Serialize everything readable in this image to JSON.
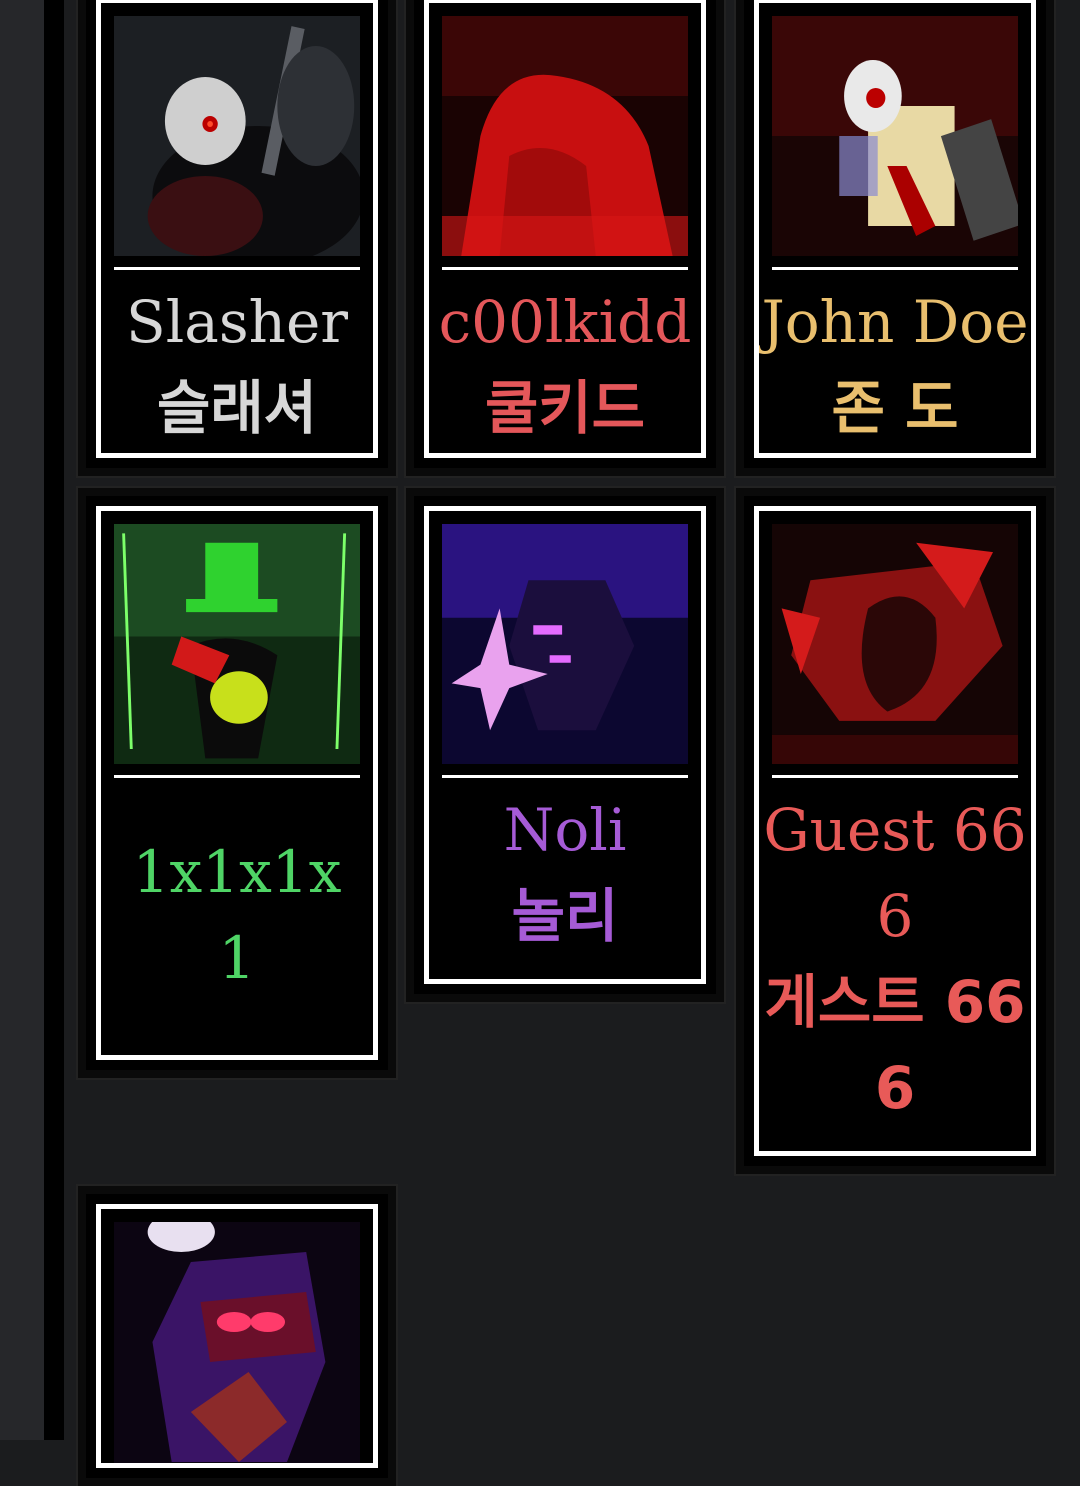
{
  "colors": {
    "slasher": "#d7d7d7",
    "c00lkidd": "#e4575a",
    "john_doe": "#e9bf6e",
    "one_x": "#4fd466",
    "noli": "#a65bd6",
    "guest": "#e85a58"
  },
  "cards": [
    {
      "name_en": "Slasher",
      "name_ko": "슬래셔"
    },
    {
      "name_en": "c00lkidd",
      "name_ko": "쿨키드"
    },
    {
      "name_en": "John Doe",
      "name_ko": "존 도"
    },
    {
      "name_en": "1x1x1x",
      "name_en_2": "1"
    },
    {
      "name_en": "Noli",
      "name_ko": "놀리"
    },
    {
      "name_en": "Guest 66",
      "name_en_2": "6",
      "name_ko": "게스트 66",
      "name_ko_2": "6"
    }
  ]
}
